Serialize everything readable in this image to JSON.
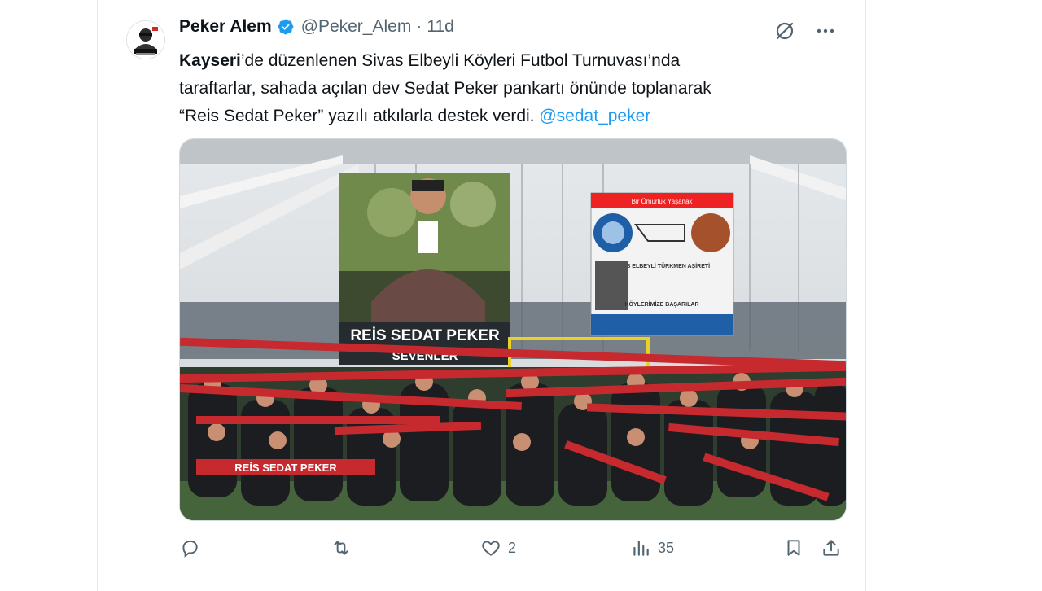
{
  "author": {
    "name": "Peker Alem",
    "handle": "@Peker_Alem",
    "separator": "·",
    "time": "11d"
  },
  "tweet": {
    "text_bold": "Kayseri",
    "text_1": "’de düzenlenen Sivas Elbeyli Köyleri Futbol Turnuvası’nda",
    "text_2": "taraftarlar, sahada açılan dev Sedat Peker pankartı önünde toplanarak",
    "text_3": "“Reis Sedat Peker” yazılı atkılarla destek verdi.",
    "mention": "@sedat_peker"
  },
  "media": {
    "banner_text": "REİS SEDAT PEKER",
    "banner_sub": "SEVENLER",
    "poster_title": "Bir Ömürlük Yaşanak",
    "poster_mid": "SİVAS ELBEYLİ TÜRKMEN AŞİRETİ",
    "poster_bottom": "KÖYLERİMİZE BAŞARILAR",
    "scarf_text": "REİS SEDAT PEKER"
  },
  "actions": {
    "likes": "2",
    "views": "35"
  },
  "colors": {
    "accent": "#1d9bf0",
    "text": "#0f1419",
    "secondary": "#536471"
  }
}
